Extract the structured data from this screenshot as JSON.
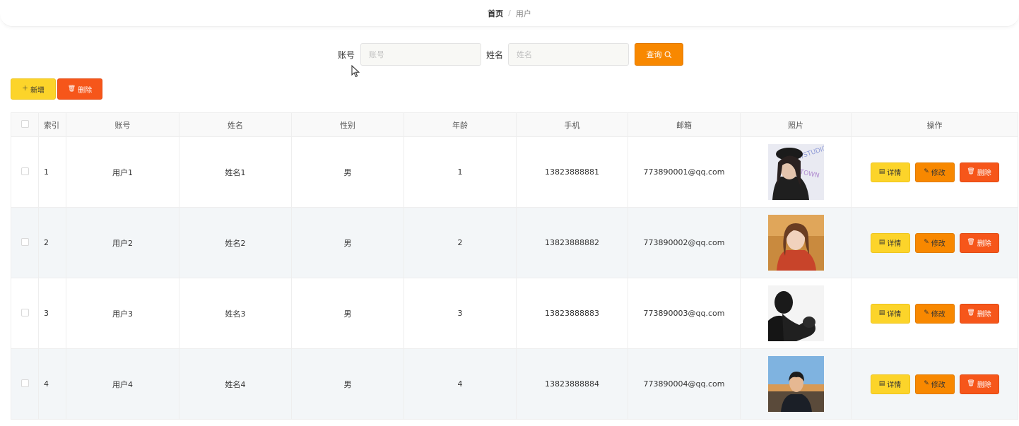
{
  "breadcrumb": {
    "home": "首页",
    "separator": "/",
    "current": "用户"
  },
  "search": {
    "account_label": "账号",
    "account_placeholder": "账号",
    "account_value": "",
    "name_label": "姓名",
    "name_placeholder": "姓名",
    "name_value": "",
    "query_label": "查询"
  },
  "toolbar": {
    "add_label": "新增",
    "delete_label": "删除"
  },
  "table": {
    "headers": {
      "index": "索引",
      "account": "账号",
      "name": "姓名",
      "gender": "性别",
      "age": "年龄",
      "phone": "手机",
      "email": "邮箱",
      "photo": "照片",
      "actions": "操作"
    },
    "action_labels": {
      "detail": "详情",
      "edit": "修改",
      "delete": "删除"
    },
    "rows": [
      {
        "index": "1",
        "account": "用户1",
        "name": "姓名1",
        "gender": "男",
        "age": "1",
        "phone": "13823888881",
        "email": "773890001@qq.com"
      },
      {
        "index": "2",
        "account": "用户2",
        "name": "姓名2",
        "gender": "男",
        "age": "2",
        "phone": "13823888882",
        "email": "773890002@qq.com"
      },
      {
        "index": "3",
        "account": "用户3",
        "name": "姓名3",
        "gender": "男",
        "age": "3",
        "phone": "13823888883",
        "email": "773890003@qq.com"
      },
      {
        "index": "4",
        "account": "用户4",
        "name": "姓名4",
        "gender": "男",
        "age": "4",
        "phone": "13823888884",
        "email": "773890004@qq.com"
      }
    ]
  },
  "colors": {
    "yellow": "#fcd42a",
    "orange": "#f88800",
    "red": "#f6561a",
    "alt_row": "#f3f6f8"
  }
}
